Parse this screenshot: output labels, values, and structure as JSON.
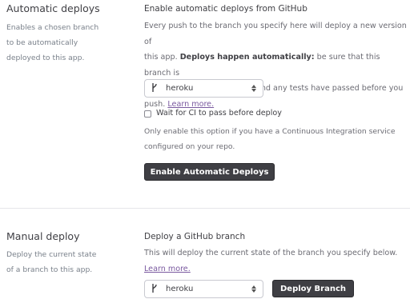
{
  "auto": {
    "title": "Automatic deploys",
    "desc_lines": [
      "Enables a chosen branch",
      "to be automatically",
      "deployed to this app."
    ],
    "heading": "Enable automatic deploys from GitHub",
    "para_lines": [
      "Every push to the branch you specify here will deploy a new version of",
      "this app. ",
      "Deploys happen automatically:",
      " be sure that this branch is",
      "always in a deployable state and any tests have passed before you",
      "push. ",
      "Learn more."
    ],
    "branch_icon": "git-branch-icon",
    "branch_value": "heroku",
    "ci_label": "Wait for CI to pass before deploy",
    "ci_note_lines": [
      "Only enable this option if you have a Continuous Integration service",
      "configured on your repo."
    ],
    "button": "Enable Automatic Deploys"
  },
  "manual": {
    "title": "Manual deploy",
    "desc_lines": [
      "Deploy the current state",
      "of a branch to this app."
    ],
    "heading": "Deploy a GitHub branch",
    "para_lines": [
      "This will deploy the current state of the branch you specify below.",
      "Learn more."
    ],
    "branch_value": "heroku",
    "button": "Deploy Branch"
  },
  "colors": {
    "button_bg": "#3f3f44",
    "link": "#79589f",
    "text": "#3f3f44",
    "muted": "#79808a"
  }
}
